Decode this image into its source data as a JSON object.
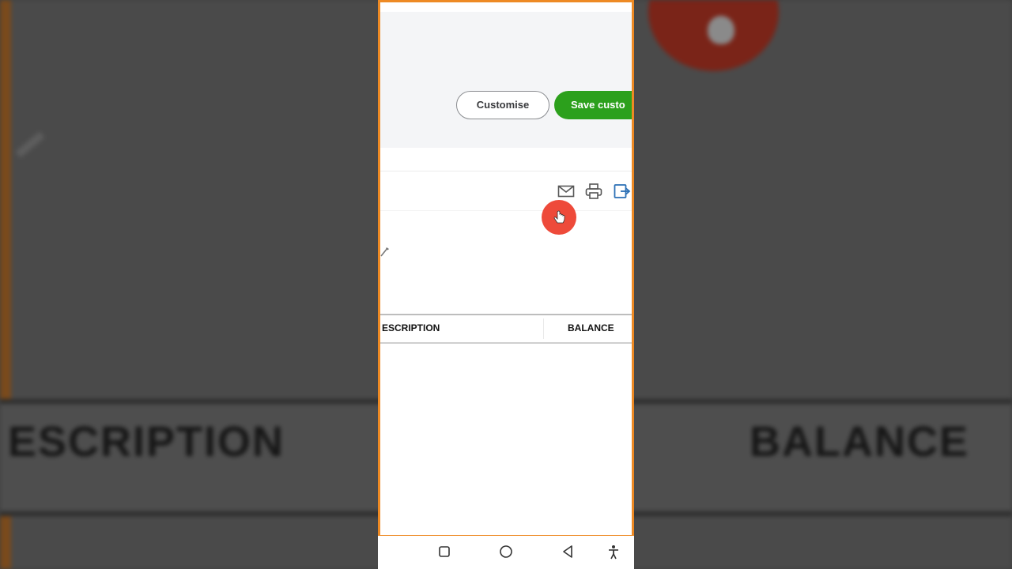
{
  "background": {
    "description_header": "ESCRIPTION",
    "balance_header": "BALANCE"
  },
  "toolbar": {
    "customise_label": "Customise",
    "save_label": "Save custo"
  },
  "report_actions": {
    "icons": [
      "email-icon",
      "print-icon",
      "export-icon"
    ]
  },
  "table": {
    "columns": [
      {
        "label": "ESCRIPTION"
      },
      {
        "label": "BALANCE"
      }
    ],
    "rows": []
  },
  "android_nav": {
    "icons": [
      "recent-apps-icon",
      "home-icon",
      "back-icon",
      "accessibility-icon"
    ]
  },
  "colors": {
    "accent_green": "#2ca01c",
    "frame_orange": "#ee8a24",
    "pointer_red": "#ee4a3a"
  }
}
